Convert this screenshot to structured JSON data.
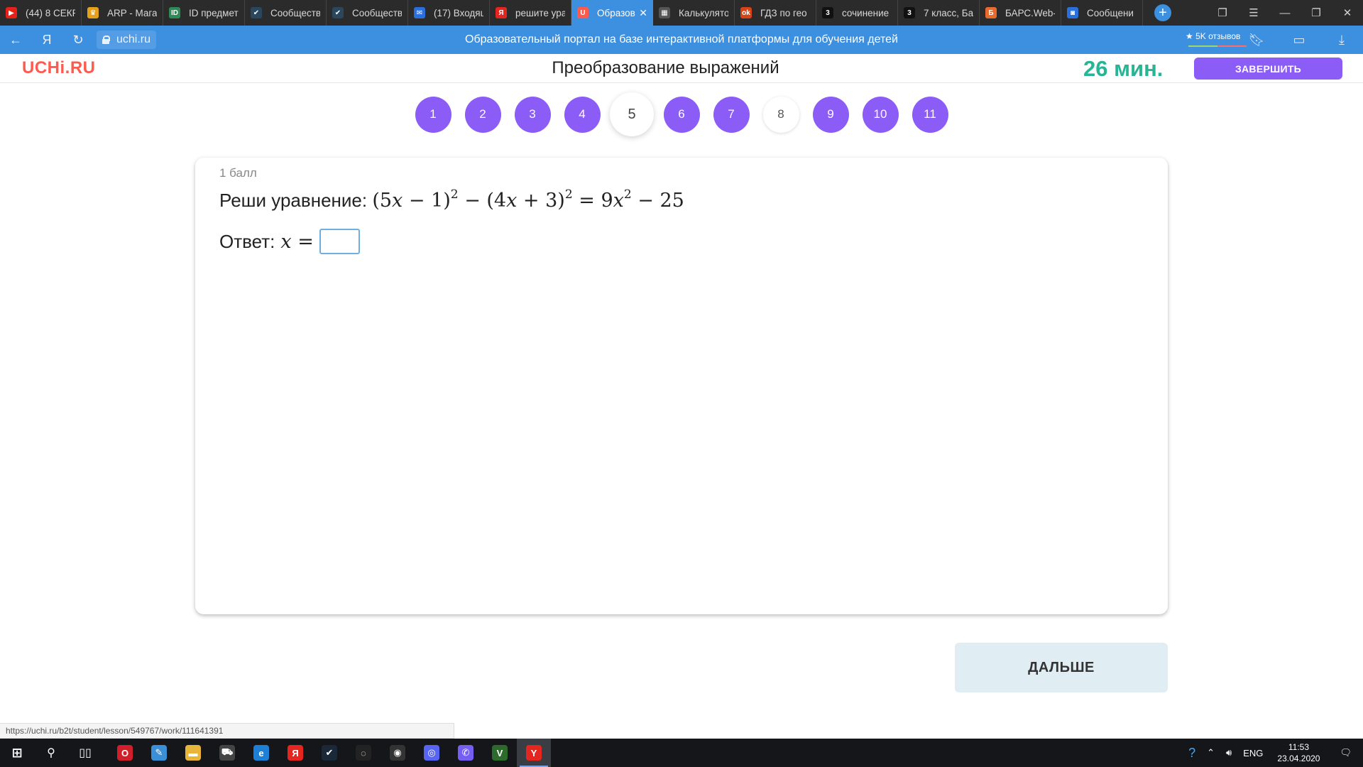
{
  "browser": {
    "tabs": [
      {
        "label": "(44) 8 СЕКР",
        "icon": "youtube-icon",
        "color": "#e62117",
        "glyph": "▶"
      },
      {
        "label": "ARP - Мага",
        "icon": "trophy-icon",
        "color": "#e3a21a",
        "glyph": "♛"
      },
      {
        "label": "ID предмет",
        "icon": "id-card-icon",
        "color": "#2e8b57",
        "glyph": "ID"
      },
      {
        "label": "Сообществ",
        "icon": "steam-icon",
        "color": "#2a475e",
        "glyph": "✔"
      },
      {
        "label": "Сообществ",
        "icon": "steam-icon",
        "color": "#2a475e",
        "glyph": "✔"
      },
      {
        "label": "(17) Входящ",
        "icon": "mail-icon",
        "color": "#2a6fdb",
        "glyph": "✉"
      },
      {
        "label": "решите ура",
        "icon": "yandex-icon",
        "color": "#e52620",
        "glyph": "Я"
      },
      {
        "label": "Образов",
        "icon": "uchi-icon",
        "color": "#ff5a4e",
        "glyph": "U"
      },
      {
        "label": "Калькулято",
        "icon": "calculator-icon",
        "color": "#555555",
        "glyph": "▦"
      },
      {
        "label": "ГДЗ по гео",
        "icon": "gdz-icon",
        "color": "#d84315",
        "glyph": "ok"
      },
      {
        "label": "сочинение",
        "icon": "znanija-icon",
        "color": "#111111",
        "glyph": "3"
      },
      {
        "label": "7 класс, Ба",
        "icon": "znanija-icon",
        "color": "#111111",
        "glyph": "3"
      },
      {
        "label": "БАРС.Web-",
        "icon": "bars-icon",
        "color": "#e86a2e",
        "glyph": "Б"
      },
      {
        "label": "Сообщени",
        "icon": "chat-icon",
        "color": "#2a6fdb",
        "glyph": "◙"
      }
    ],
    "active_tab_index": 7,
    "url": "uchi.ru",
    "page_heading": "Образовательный портал на базе интерактивной платформы для обучения детей",
    "reviews_label": "★ 5K отзывов",
    "status_url": "https://uchi.ru/b2t/student/lesson/549767/work/111641391"
  },
  "header": {
    "logo": "UCHi.RU",
    "title": "Преобразование выражений",
    "timer": "26 мин.",
    "finish_label": "ЗАВЕРШИТЬ"
  },
  "task_nav": {
    "current": "5",
    "items": [
      {
        "label": "1",
        "state": "done"
      },
      {
        "label": "2",
        "state": "done"
      },
      {
        "label": "3",
        "state": "done"
      },
      {
        "label": "4",
        "state": "done"
      },
      {
        "label": "5",
        "state": "current"
      },
      {
        "label": "6",
        "state": "done"
      },
      {
        "label": "7",
        "state": "done"
      },
      {
        "label": "8",
        "state": "open"
      },
      {
        "label": "9",
        "state": "done"
      },
      {
        "label": "10",
        "state": "done"
      },
      {
        "label": "11",
        "state": "done"
      }
    ]
  },
  "task": {
    "points": "1 балл",
    "prompt": "Реши уравнение:",
    "answer_label": "Ответ:",
    "answer_value": "",
    "next_label": "ДАЛЬШЕ"
  },
  "taskbar": {
    "apps": [
      {
        "name": "opera-icon",
        "color": "#d01f2a",
        "glyph": "O"
      },
      {
        "name": "notes-icon",
        "color": "#3a8fd6",
        "glyph": "✎"
      },
      {
        "name": "folder-icon",
        "color": "#e8b43a",
        "glyph": "▬"
      },
      {
        "name": "store-icon",
        "color": "#444444",
        "glyph": "⛟"
      },
      {
        "name": "edge-icon",
        "color": "#1e7fd6",
        "glyph": "e"
      },
      {
        "name": "yandex-browser-icon",
        "color": "#e52620",
        "glyph": "Я"
      },
      {
        "name": "steam-icon",
        "color": "#1b2838",
        "glyph": "✔"
      },
      {
        "name": "app-icon",
        "color": "#222222",
        "glyph": "◌"
      },
      {
        "name": "obs-icon",
        "color": "#333333",
        "glyph": "◉"
      },
      {
        "name": "discord-icon",
        "color": "#5865f2",
        "glyph": "◎"
      },
      {
        "name": "viber-icon",
        "color": "#7360f2",
        "glyph": "✆"
      },
      {
        "name": "gta-icon",
        "color": "#2d6b2d",
        "glyph": "V"
      },
      {
        "name": "yandex-icon",
        "color": "#e52620",
        "glyph": "Y"
      }
    ],
    "active_app_index": 12,
    "language": "ENG",
    "time": "11:53",
    "date": "23.04.2020"
  }
}
